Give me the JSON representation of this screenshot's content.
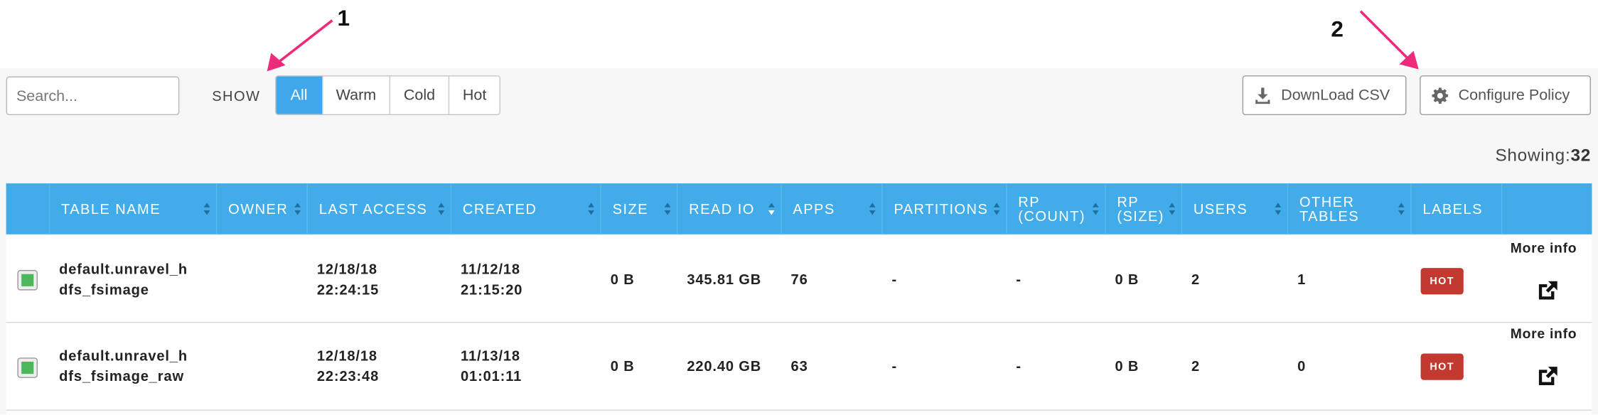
{
  "annotations": [
    "1",
    "2"
  ],
  "search": {
    "placeholder": "Search..."
  },
  "show_label": "SHOW",
  "filters": [
    {
      "label": "All",
      "active": true
    },
    {
      "label": "Warm",
      "active": false
    },
    {
      "label": "Cold",
      "active": false
    },
    {
      "label": "Hot",
      "active": false
    }
  ],
  "toolbar": {
    "download_label": "DownLoad CSV",
    "configure_label": "Configure Policy"
  },
  "showing": {
    "label": "Showing:",
    "count": "32"
  },
  "table": {
    "columns": [
      "TABLE NAME",
      "OWNER",
      "LAST ACCESS",
      "CREATED",
      "SIZE",
      "READ IO",
      "APPS",
      "PARTITIONS",
      "RP (COUNT)",
      "RP (SIZE)",
      "USERS",
      "OTHER TABLES",
      "LABELS"
    ],
    "column_lines": [
      [
        "TABLE NAME"
      ],
      [
        "OWNER"
      ],
      [
        "LAST ACCESS"
      ],
      [
        "CREATED"
      ],
      [
        "SIZE"
      ],
      [
        "READ IO"
      ],
      [
        "APPS"
      ],
      [
        "PARTITIONS"
      ],
      [
        "RP",
        "(COUNT)"
      ],
      [
        "RP",
        "(SIZE)"
      ],
      [
        "USERS"
      ],
      [
        "OTHER",
        "TABLES"
      ],
      [
        "LABELS"
      ]
    ],
    "rows": [
      {
        "name_lines": [
          "default.unravel_h",
          "dfs_fsimage"
        ],
        "owner": "",
        "last_access": [
          "12/18/18",
          "22:24:15"
        ],
        "created": [
          "11/12/18",
          "21:15:20"
        ],
        "size": "0 B",
        "read_io": "345.81 GB",
        "apps": "76",
        "partitions": "-",
        "rp_count": "-",
        "rp_size": "0 B",
        "users": "2",
        "other_tables": "1",
        "label": "HOT",
        "more_info": "More info"
      },
      {
        "name_lines": [
          "default.unravel_h",
          "dfs_fsimage_raw"
        ],
        "owner": "",
        "last_access": [
          "12/18/18",
          "22:23:48"
        ],
        "created": [
          "11/13/18",
          "01:01:11"
        ],
        "size": "0 B",
        "read_io": "220.40 GB",
        "apps": "63",
        "partitions": "-",
        "rp_count": "-",
        "rp_size": "0 B",
        "users": "2",
        "other_tables": "0",
        "label": "HOT",
        "more_info": "More info"
      }
    ]
  },
  "colors": {
    "accent": "#42abea",
    "hot_badge": "#c23930",
    "checkbox_fill": "#4cb85c",
    "annotation_arrow": "#ee2b7a"
  }
}
